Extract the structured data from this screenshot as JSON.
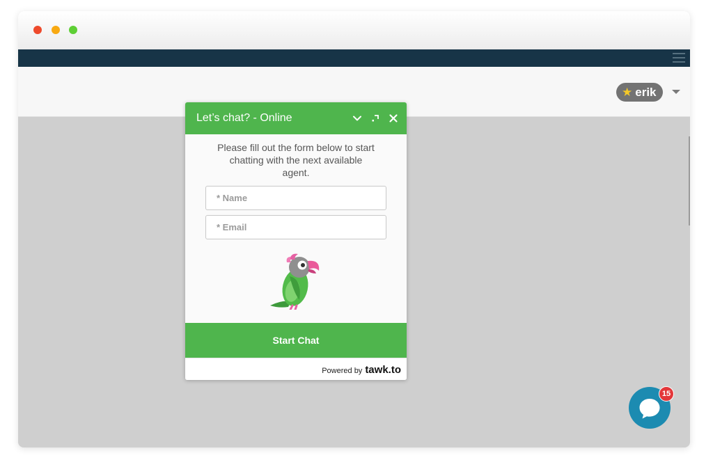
{
  "app": {
    "user": {
      "name": "erik",
      "star_icon": "star-icon"
    }
  },
  "colors": {
    "accent": "#4fb54d",
    "navbar": "#173447",
    "chat_bubble": "#1c8bb1",
    "badge": "#e3373a"
  },
  "chat_widget": {
    "title": "Let’s chat? - Online",
    "controls": [
      "minimize-icon",
      "popout-icon",
      "close-icon"
    ],
    "message": "Please fill out the form below to start chatting with the next available agent.",
    "name_field": {
      "placeholder": "* Name",
      "value": ""
    },
    "email_field": {
      "placeholder": "* Email",
      "value": ""
    },
    "mascot": "parrot",
    "start_button": "Start Chat",
    "footer": {
      "powered_by": "Powered by",
      "brand": "tawk.to"
    }
  },
  "chat_launcher": {
    "icon": "chat-bubble-icon",
    "badge_count": "15"
  }
}
